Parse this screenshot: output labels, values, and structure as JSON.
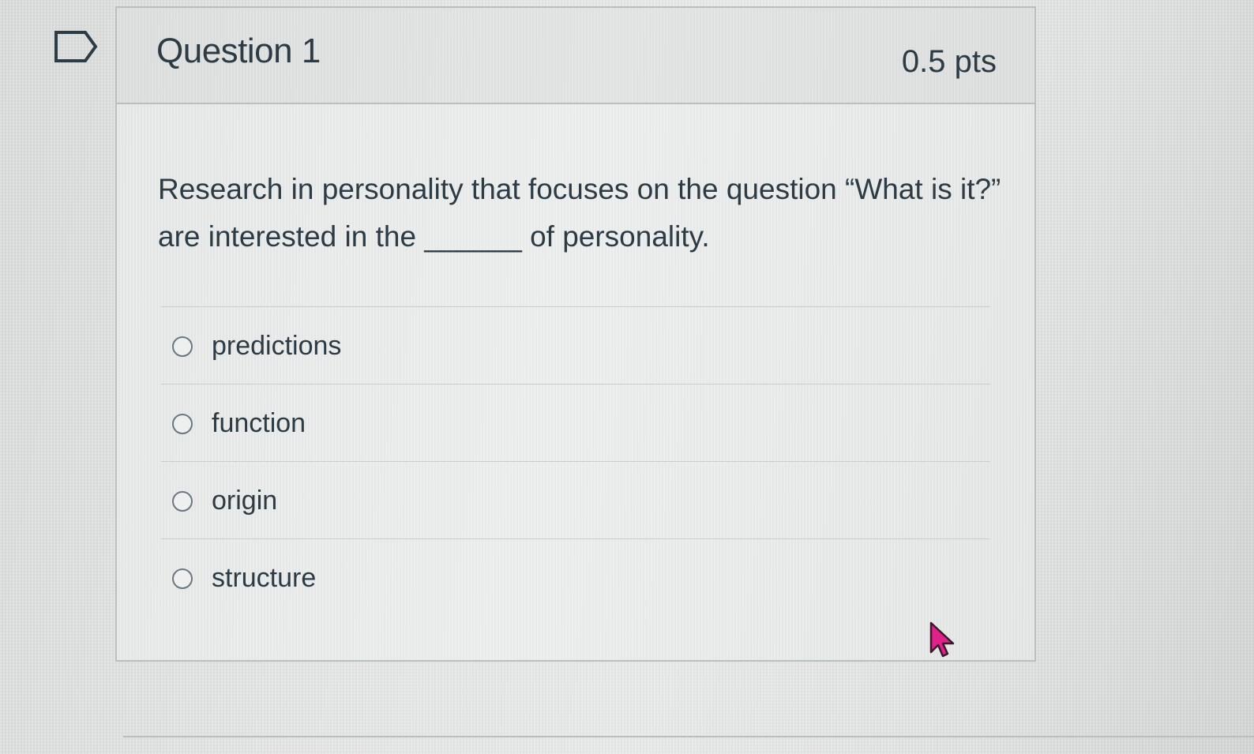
{
  "question": {
    "title": "Question 1",
    "points": "0.5 pts",
    "text": "Research in personality that focuses on the question “What is it?” are interested in the ______ of personality."
  },
  "answers": [
    {
      "label": "predictions",
      "selected": false
    },
    {
      "label": "function",
      "selected": false
    },
    {
      "label": "origin",
      "selected": false
    },
    {
      "label": "structure",
      "selected": false
    }
  ],
  "icons": {
    "flag": "flag-question-icon",
    "cursor": "mouse-pointer-icon"
  },
  "colors": {
    "text": "#2d3b45",
    "border": "#b9bebf",
    "cursor_fill": "#e0218a"
  }
}
